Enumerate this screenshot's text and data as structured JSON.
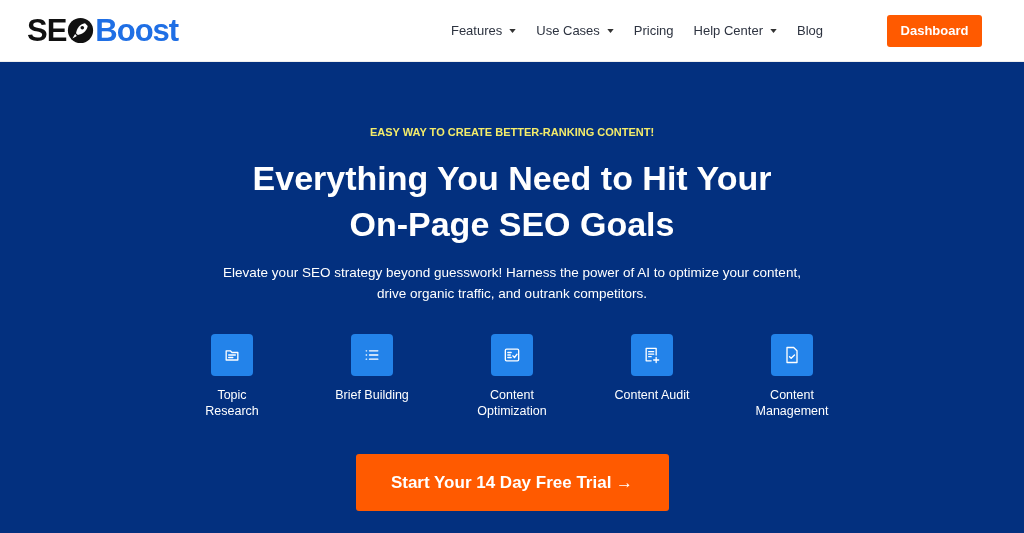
{
  "logo": {
    "dark_part": "SE",
    "blue_part": "Boost"
  },
  "nav": [
    {
      "label": "Features",
      "dropdown": true
    },
    {
      "label": "Use Cases",
      "dropdown": true
    },
    {
      "label": "Pricing",
      "dropdown": false
    },
    {
      "label": "Help Center",
      "dropdown": true
    },
    {
      "label": "Blog",
      "dropdown": false
    }
  ],
  "dashboard_button": "Dashboard",
  "hero": {
    "tagline": "EASY WAY TO CREATE BETTER-RANKING CONTENT!",
    "heading_lines": [
      "Everything You Need to Hit Your",
      "On-Page SEO Goals"
    ],
    "description_lines": [
      "Elevate your SEO strategy beyond guesswork! Harness the power of AI to optimize your content,",
      "drive organic traffic, and outrank competitors."
    ],
    "features": [
      {
        "kind": "folder",
        "label_lines": [
          "Topic",
          "Research"
        ]
      },
      {
        "kind": "list",
        "label_lines": [
          "Brief Building"
        ]
      },
      {
        "kind": "checklist",
        "label_lines": [
          "Content",
          "Optimization"
        ]
      },
      {
        "kind": "audit",
        "label_lines": [
          "Content Audit"
        ]
      },
      {
        "kind": "document",
        "label_lines": [
          "Content",
          "Management"
        ]
      }
    ],
    "cta": "Start Your 14 Day Free Trial →"
  }
}
